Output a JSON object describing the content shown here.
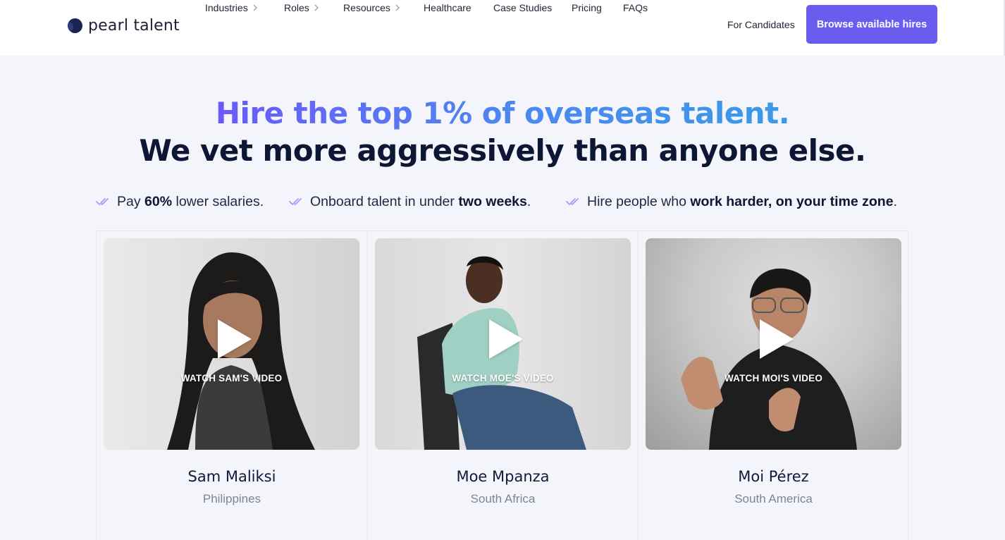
{
  "nav": {
    "logo_text": "pearl talent",
    "links": [
      {
        "label": "Industries",
        "has_chevron": true
      },
      {
        "label": "Roles",
        "has_chevron": true
      },
      {
        "label": "Resources",
        "has_chevron": true
      },
      {
        "label": "Healthcare",
        "has_chevron": false
      },
      {
        "label": "Case Studies",
        "has_chevron": false
      },
      {
        "label": "Pricing",
        "has_chevron": false
      },
      {
        "label": "FAQs",
        "has_chevron": false
      }
    ],
    "candidates_label": "For Candidates",
    "cta_label": "Browse available hires"
  },
  "hero": {
    "headline_1": "Hire the top 1% of overseas talent.",
    "headline_2": "We vet more aggressively than anyone else."
  },
  "bullets": [
    {
      "pre": "Pay ",
      "bold": "60%",
      "post": " lower salaries."
    },
    {
      "pre": "Onboard talent in under ",
      "bold": "two weeks",
      "post": "."
    },
    {
      "pre": "Hire people who ",
      "bold": "work harder, on your time zone",
      "post": "."
    }
  ],
  "cards": [
    {
      "watch_label": "WATCH SAM'S VIDEO",
      "name": "Sam Maliksi",
      "location": "Philippines"
    },
    {
      "watch_label": "WATCH MOE'S VIDEO",
      "name": "Moe Mpanza",
      "location": "South Africa"
    },
    {
      "watch_label": "WATCH MOI'S VIDEO",
      "name": "Moi Pérez",
      "location": "South America"
    }
  ],
  "colors": {
    "accent": "#6b5cf0",
    "page_bg": "#f4f5fb",
    "heading": "#0e1636",
    "gradient_start": "#6a5af9",
    "gradient_end": "#3a9ae6",
    "check": "#a99cf5"
  },
  "icons": {
    "nav_chevron": "chevron-right-icon",
    "bullet": "double-check-icon",
    "video": "play-icon"
  }
}
